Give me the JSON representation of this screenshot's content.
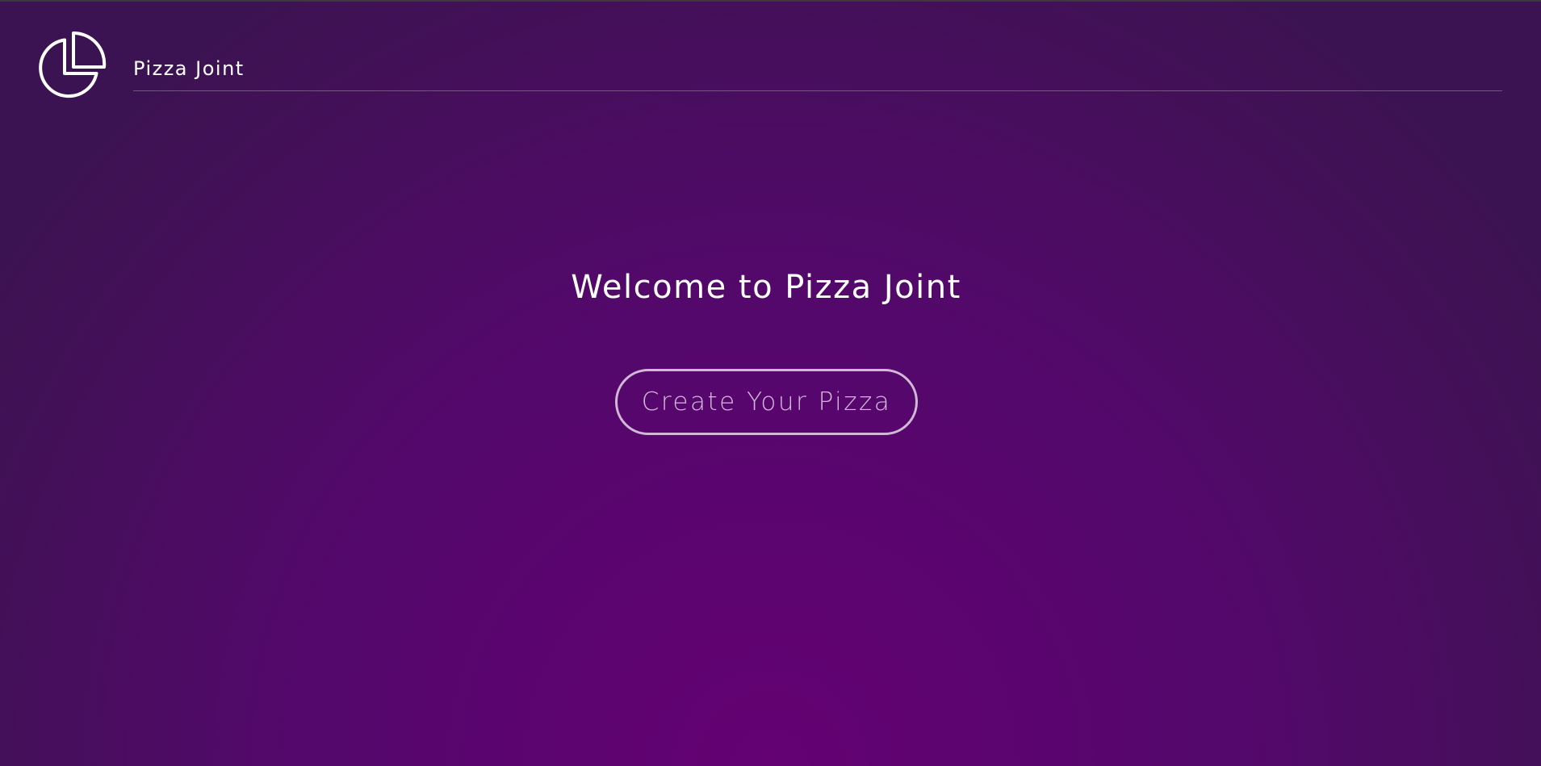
{
  "header": {
    "logo_icon": "pie-chart-icon",
    "brand": "Pizza Joint"
  },
  "main": {
    "title": "Welcome to Pizza Joint",
    "cta_label": "Create Your Pizza"
  },
  "colors": {
    "background_center": "#640273",
    "background_edge": "#3c1352",
    "text": "#ffffff"
  }
}
